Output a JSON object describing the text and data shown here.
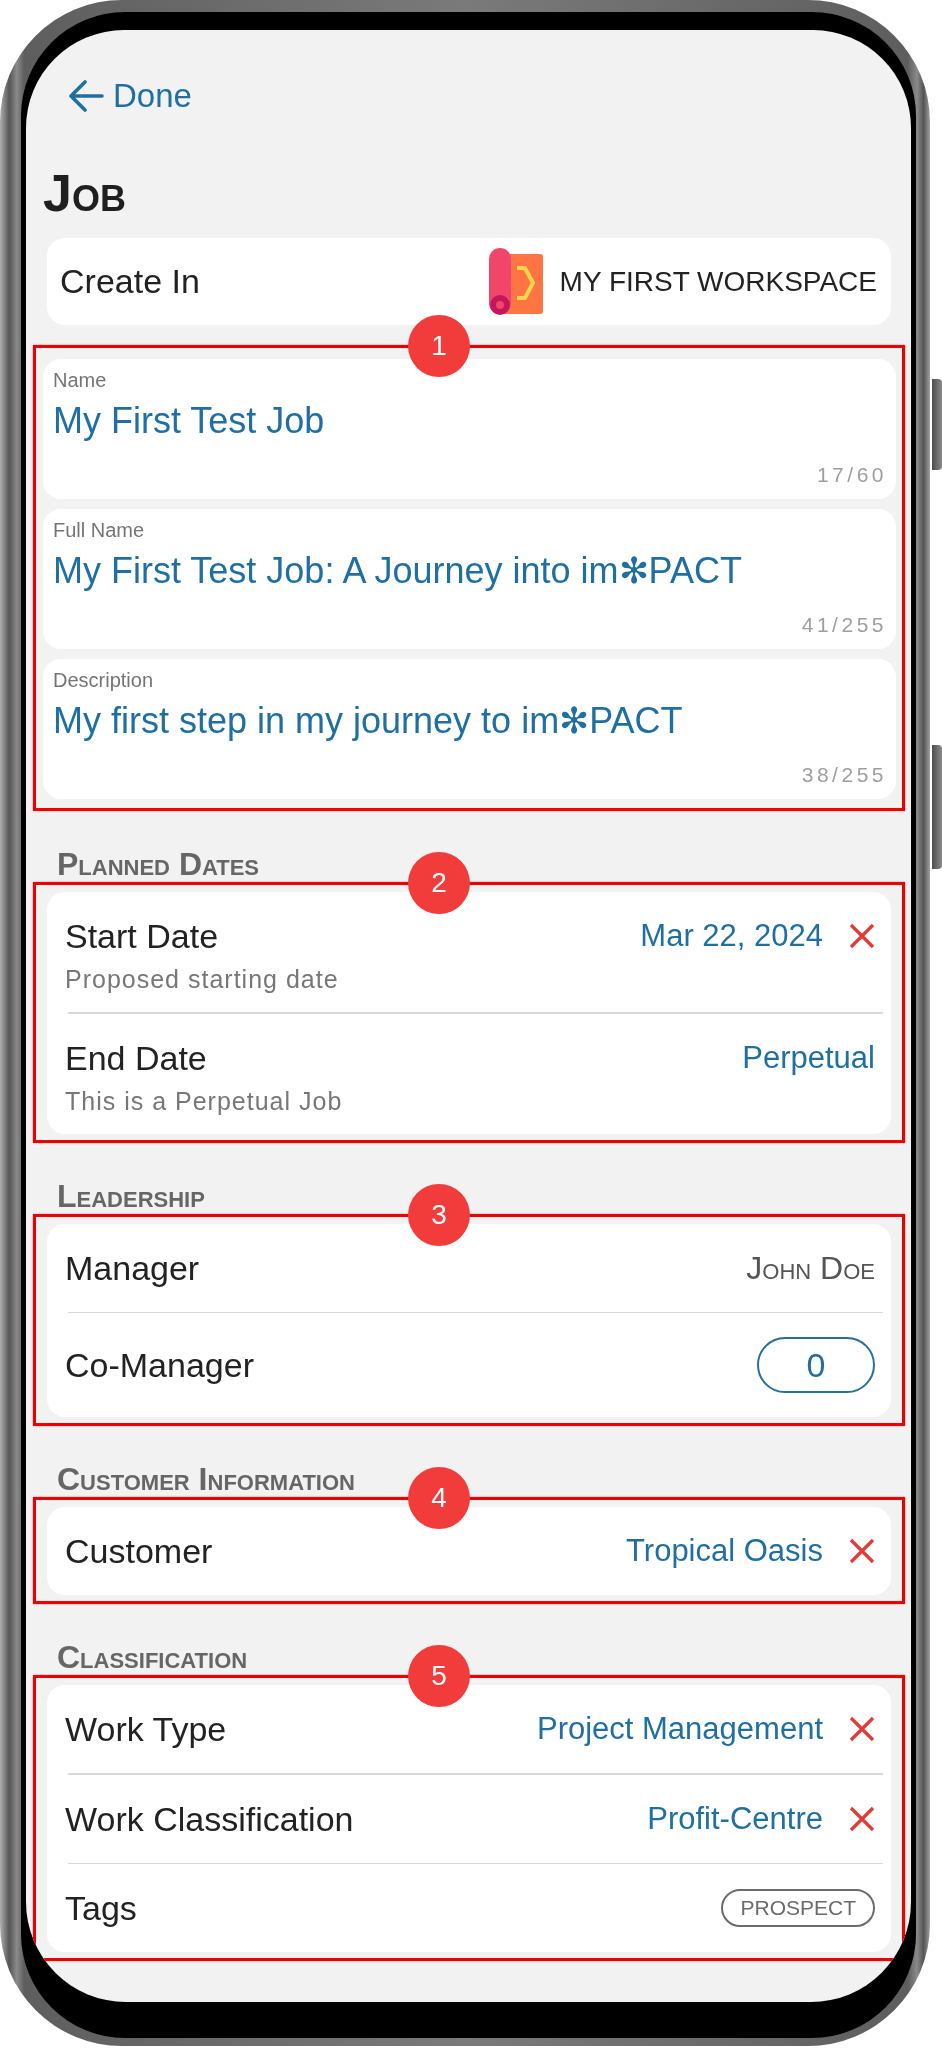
{
  "nav": {
    "back_label": "Done"
  },
  "title": "Job",
  "create_in": {
    "label": "Create In",
    "workspace": "MY FIRST WORKSPACE"
  },
  "sections": [
    {
      "kind": "fields",
      "callout": "1",
      "fields": [
        {
          "label": "Name",
          "value": "My First Test Job",
          "counter": "17/60"
        },
        {
          "label": "Full Name",
          "value": "My First Test Job: A Journey into im✻PACT",
          "counter": "41/255"
        },
        {
          "label": "Description",
          "value": "My first step in my journey to im✻PACT",
          "counter": "38/255"
        }
      ]
    },
    {
      "kind": "list",
      "callout": "2",
      "heading": "Planned Dates",
      "rows": [
        {
          "kind": "link",
          "label": "Start Date",
          "subtitle": "Proposed starting date",
          "value": "Mar 22, 2024",
          "clearable": true
        },
        {
          "kind": "link",
          "label": "End Date",
          "subtitle": "This is a Perpetual Job",
          "value": "Perpetual",
          "clearable": false
        }
      ]
    },
    {
      "kind": "list",
      "callout": "3",
      "heading": "Leadership",
      "rows": [
        {
          "kind": "person",
          "label": "Manager",
          "value": "John Doe",
          "clearable": false
        },
        {
          "kind": "count",
          "label": "Co-Manager",
          "value": "0",
          "clearable": false
        }
      ]
    },
    {
      "kind": "list",
      "callout": "4",
      "heading": "Customer Information",
      "rows": [
        {
          "kind": "link",
          "label": "Customer",
          "value": "Tropical Oasis",
          "clearable": true
        }
      ]
    },
    {
      "kind": "list",
      "callout": "5",
      "heading": "Classification",
      "rows": [
        {
          "kind": "link",
          "label": "Work Type",
          "value": "Project Management",
          "clearable": true
        },
        {
          "kind": "link",
          "label": "Work Classification",
          "value": "Profit-Centre",
          "clearable": true
        },
        {
          "kind": "tag",
          "label": "Tags",
          "value": "PROSPECT",
          "clearable": false
        }
      ]
    }
  ]
}
